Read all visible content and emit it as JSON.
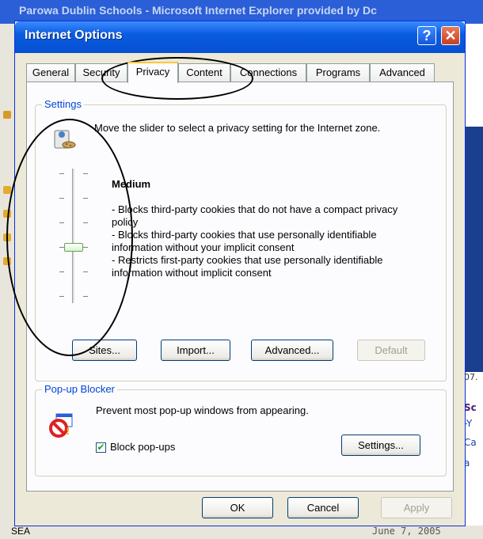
{
  "background": {
    "title": "Parowa Dublin Schools - Microsoft Internet Explorer provided by Dc",
    "status_left": "SEA",
    "status_date": "June 7, 2005",
    "right_fragments": [
      "07.",
      "Sc",
      "-Y",
      "Ca",
      "a"
    ]
  },
  "dialog": {
    "title": "Internet Options",
    "help_glyph": "?",
    "close_glyph": "✕",
    "tabs": [
      {
        "label": "General"
      },
      {
        "label": "Security"
      },
      {
        "label": "Privacy",
        "active": true
      },
      {
        "label": "Content"
      },
      {
        "label": "Connections"
      },
      {
        "label": "Programs"
      },
      {
        "label": "Advanced"
      }
    ],
    "settings": {
      "group_label": "Settings",
      "intro": "Move the slider to select a privacy setting for the Internet zone.",
      "level_name": "Medium",
      "slider_level_index": 3,
      "slider_level_count": 6,
      "description": [
        "- Blocks third-party cookies that do not have a compact privacy policy",
        "- Blocks third-party cookies that use personally identifiable information without your implicit consent",
        "- Restricts first-party cookies that use personally identifiable information without implicit consent"
      ],
      "buttons": {
        "sites": "Sites...",
        "import": "Import...",
        "advanced": "Advanced...",
        "default": "Default"
      }
    },
    "popup": {
      "group_label": "Pop-up Blocker",
      "text": "Prevent most pop-up windows from appearing.",
      "checkbox_label": "Block pop-ups",
      "checkbox_checked": true,
      "checkbox_glyph": "✔",
      "settings_button": "Settings..."
    },
    "footer": {
      "ok": "OK",
      "cancel": "Cancel",
      "apply": "Apply"
    }
  },
  "colors": {
    "title_bar": "#0a5ce0",
    "group_label": "#0046d5",
    "active_tab_accent": "#ffc83c"
  }
}
